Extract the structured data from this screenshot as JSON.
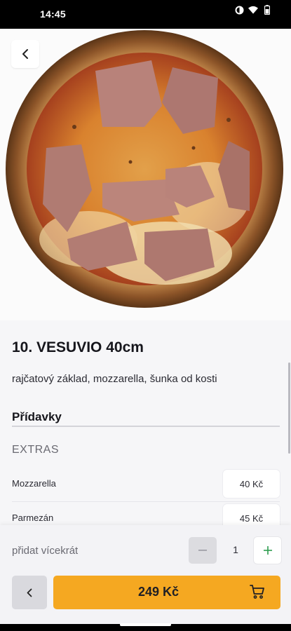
{
  "status": {
    "time": "14:45",
    "icons": [
      "data-saver-icon",
      "wifi-icon",
      "battery-icon"
    ]
  },
  "product": {
    "title": "10. VESUVIO 40cm",
    "description": "rajčatový základ, mozzarella, šunka od kosti",
    "image_icon": "pizza-photo"
  },
  "addons": {
    "section_title": "Přídavky",
    "group_label": "EXTRAS",
    "items": [
      {
        "name": "Mozzarella",
        "price": "40 Kč"
      },
      {
        "name": "Parmezán",
        "price": "45 Kč"
      }
    ]
  },
  "footer": {
    "add_more_label": "přidat vícekrát",
    "quantity": "1",
    "minus_icon": "minus-icon",
    "plus_icon": "plus-icon",
    "total_price": "249 Kč",
    "cart_icon": "cart-icon",
    "back_icon": "chevron-left-icon"
  },
  "colors": {
    "accent": "#f5a821",
    "background": "#f6f6f8",
    "plus_green": "#2e9c4f"
  }
}
